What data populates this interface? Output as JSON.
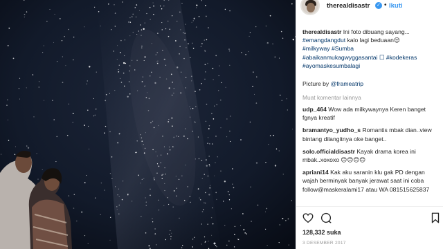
{
  "post": {
    "username": "therealdisastr",
    "verified_mark": "✓",
    "separator": "•",
    "follow_label": "Ikuti"
  },
  "caption": {
    "username": "therealdisastr",
    "line1": "Ini foto dibuang sayang...",
    "line2_tag": "#emangdangdut",
    "line2_text": " kalo lagi beduaan😒",
    "line3_tags": "#milkyway #Sumba",
    "line4_tag": "#abaikanmukagwyggasantai",
    "line4_text": " ☐ #kodekeras",
    "line5_tag": "#ayomaskesumbalagi"
  },
  "credit": {
    "prefix": "Picture by ",
    "handle": "@frameatrip"
  },
  "load_more": "Muat komentar lainnya",
  "comments": [
    {
      "user": "udp_464",
      "text": " Wow ada milkywaynya Keren banget fgnya kreatif"
    },
    {
      "user": "bramantyo_yudho_s",
      "text": " Romantis mbak dian..view bintang dilangitnya oke banget.."
    },
    {
      "user": "solo.officialdisastr",
      "text": " Kayak drama korea ini mbak..xoxoxo 😊😊😊😊"
    },
    {
      "user": "apriani14",
      "text": " Kak aku saranin klu gak PD dengan wajah berminyak banyak jerawat saat ini coba follow@maskeralami17 atau WA 081515625837"
    }
  ],
  "likes": "128,332 suka",
  "date": "3 DESEMBER 2017",
  "icons": {
    "like": "heart-icon",
    "comment": "comment-bubble-icon",
    "save": "bookmark-icon"
  },
  "colors": {
    "link": "#003569",
    "accent": "#3897f0",
    "muted": "#999999",
    "sky": "#0c1220"
  }
}
